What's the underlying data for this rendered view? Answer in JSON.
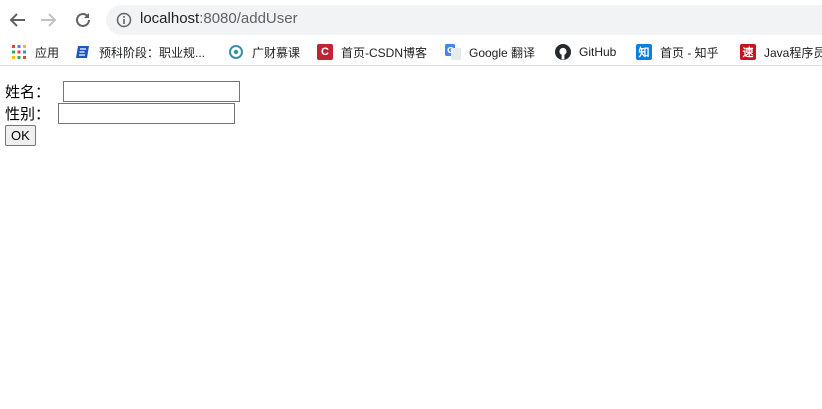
{
  "browser": {
    "url_host": "localhost",
    "url_path": ":8080/addUser"
  },
  "bookmarks": [
    {
      "label": "应用",
      "icon": "apps-grid-icon"
    },
    {
      "label": "预科阶段：职业规...",
      "icon": "edu-icon"
    },
    {
      "label": "广财慕课",
      "icon": "mooc-icon"
    },
    {
      "label": "首页-CSDN博客",
      "icon": "csdn-icon",
      "icon_text": "C"
    },
    {
      "label": "Google 翻译",
      "icon": "google-translate-icon"
    },
    {
      "label": "GitHub",
      "icon": "github-icon"
    },
    {
      "label": "首页 - 知乎",
      "icon": "zhihu-icon",
      "icon_text": "知"
    },
    {
      "label": "Java程序员",
      "icon": "java-icon",
      "icon_text": "速"
    }
  ],
  "form": {
    "name_label": "姓名：",
    "name_value": "",
    "gender_label": "性别：",
    "gender_value": "",
    "submit_label": "OK"
  },
  "colors": {
    "csdn": "#c32136",
    "zhihu": "#0a7fe2",
    "java": "#c8101f",
    "edu": "#1a56c4"
  }
}
